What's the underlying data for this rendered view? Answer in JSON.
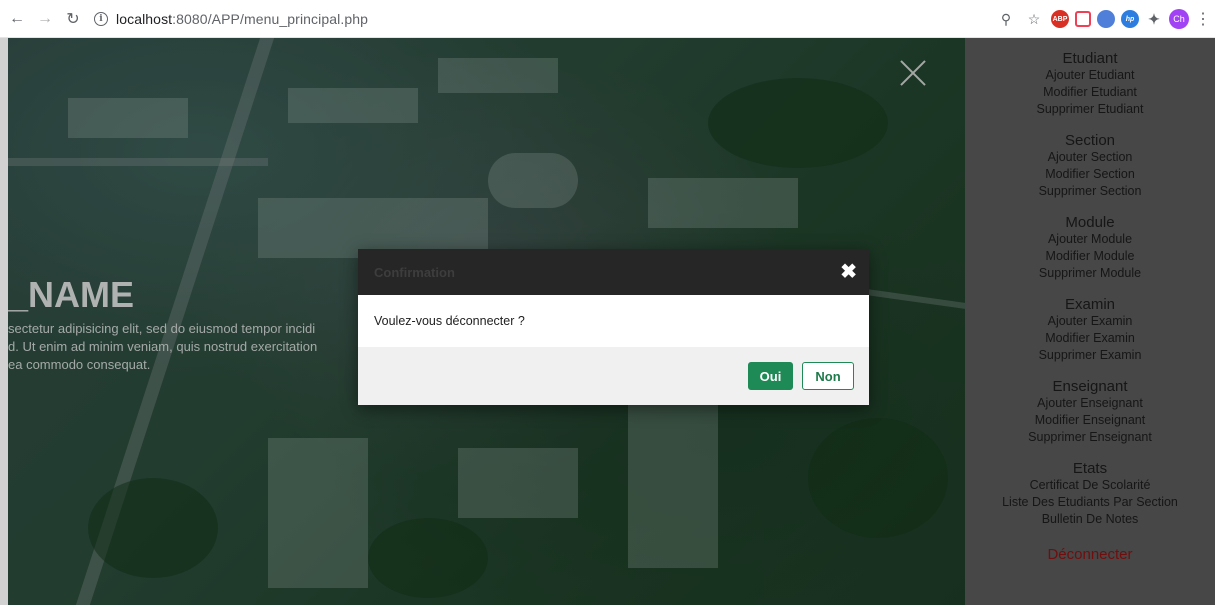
{
  "browser": {
    "url_host": "localhost",
    "url_path": ":8080/APP/menu_principal.php",
    "profile_initials": "Ch",
    "extensions": [
      "ABP",
      "pocket",
      "ext-blue",
      "hp",
      "puzzle"
    ]
  },
  "hero": {
    "title": "_NAME",
    "text_lines": [
      "sectetur adipisicing elit, sed do eiusmod tempor incidi",
      "d. Ut enim ad minim veniam, quis nostrud exercitation",
      "ea commodo consequat."
    ]
  },
  "sidebar": {
    "sections": [
      {
        "title": "Etudiant",
        "items": [
          "Ajouter Etudiant",
          "Modifier Etudiant",
          "Supprimer Etudiant"
        ]
      },
      {
        "title": "Section",
        "items": [
          "Ajouter Section",
          "Modifier Section",
          "Supprimer Section"
        ]
      },
      {
        "title": "Module",
        "items": [
          "Ajouter Module",
          "Modifier Module",
          "Supprimer Module"
        ]
      },
      {
        "title": "Examin",
        "items": [
          "Ajouter Examin",
          "Modifier Examin",
          "Supprimer Examin"
        ]
      },
      {
        "title": "Enseignant",
        "items": [
          "Ajouter Enseignant",
          "Modifier Enseignant",
          "Supprimer Enseignant"
        ]
      },
      {
        "title": "Etats",
        "items": [
          "Certificat De Scolarité",
          "Liste Des Etudiants Par Section",
          "Bulletin De Notes"
        ]
      }
    ],
    "logout": "Déconnecter"
  },
  "modal": {
    "title": "Confirmation",
    "message": "Voulez-vous déconnecter ?",
    "yes_label": "Oui",
    "no_label": "Non"
  },
  "colors": {
    "sidebar_bg": "#575757",
    "logout": "#8a1111",
    "primary_green": "#1e8a55",
    "modal_header": "#262626"
  }
}
